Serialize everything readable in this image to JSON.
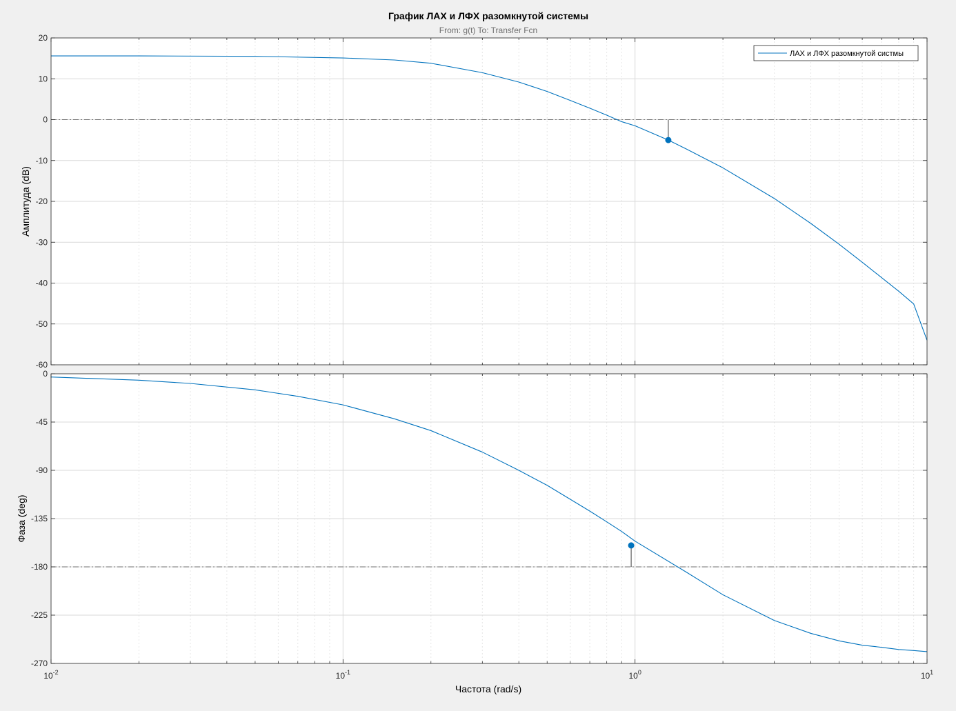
{
  "chart_data": {
    "type": "line",
    "title": "График ЛАХ и ЛФХ разомкнутой системы",
    "subtitle": "From: g(t)  To: Transfer Fcn",
    "xlabel": "Частота  (rad/s)",
    "xscale": "log",
    "xlim": [
      0.01,
      10
    ],
    "xticks": [
      {
        "base": "10",
        "exp": "-2"
      },
      {
        "base": "10",
        "exp": "-1"
      },
      {
        "base": "10",
        "exp": "0"
      },
      {
        "base": "10",
        "exp": "1"
      }
    ],
    "grid": true,
    "legend": {
      "placement": "top-right",
      "entries": [
        "ЛАХ и ЛФХ разомкнутой систмы"
      ]
    },
    "colors": {
      "line": "#0072bd",
      "reference": "#707070",
      "marker": "#0072bd"
    },
    "magnitude": {
      "ylabel": "Амплитуда (dB)",
      "ylim": [
        -60,
        20
      ],
      "yticks": [
        "20",
        "10",
        "0",
        "-10",
        "-20",
        "-30",
        "-40",
        "-50",
        "-60"
      ],
      "reference_line": 0,
      "series": [
        {
          "x": [
            0.01,
            0.02,
            0.05,
            0.1,
            0.15,
            0.2,
            0.3,
            0.4,
            0.5,
            0.6,
            0.7,
            0.8,
            0.9,
            1.0,
            1.3,
            1.5,
            2,
            3,
            4,
            5,
            6,
            7,
            8,
            9,
            10
          ],
          "y": [
            15.6,
            15.6,
            15.5,
            15.1,
            14.6,
            13.8,
            11.5,
            9.2,
            6.9,
            4.7,
            2.8,
            1.1,
            -0.5,
            -1.5,
            -5.0,
            -7.2,
            -11.8,
            -19.3,
            -25.4,
            -30.5,
            -34.9,
            -38.7,
            -42.0,
            -45.1,
            -54.0
          ]
        }
      ],
      "margin_marker": {
        "x": 1.3,
        "y": -5.0,
        "ref": 0
      }
    },
    "phase": {
      "ylabel": "Фаза (deg)",
      "ylim": [
        -270,
        0
      ],
      "yticks": [
        "0",
        "-45",
        "-90",
        "-135",
        "-180",
        "-225",
        "-270"
      ],
      "reference_line": -180,
      "series": [
        {
          "x": [
            0.01,
            0.02,
            0.03,
            0.05,
            0.07,
            0.1,
            0.15,
            0.2,
            0.3,
            0.4,
            0.5,
            0.6,
            0.7,
            0.8,
            0.9,
            1.0,
            1.5,
            2,
            3,
            4,
            5,
            6,
            7,
            8,
            9,
            10
          ],
          "y": [
            -3,
            -6,
            -9,
            -15,
            -21,
            -29,
            -42,
            -53,
            -73,
            -90,
            -104,
            -117,
            -128,
            -138,
            -147,
            -156,
            -185,
            -206,
            -230,
            -242,
            -249,
            -253,
            -255,
            -257,
            -258,
            -259
          ]
        }
      ],
      "margin_marker": {
        "x": 0.97,
        "y": -160,
        "ref": -180
      }
    }
  }
}
